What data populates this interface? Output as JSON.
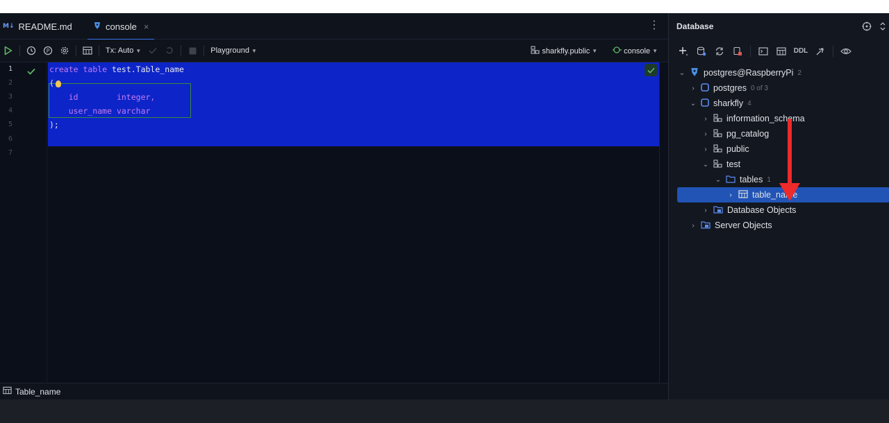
{
  "tabs": [
    {
      "badge": "M↓",
      "label": "README.md"
    },
    {
      "label": "console",
      "close": "×"
    }
  ],
  "toolbar": {
    "tx_mode": "Tx: Auto",
    "playground": "Playground",
    "schema": "sharkfly.public",
    "session": "console"
  },
  "editor": {
    "line_numbers": [
      "1",
      "2",
      "3",
      "4",
      "5",
      "6",
      "7"
    ],
    "code": {
      "l1_kw1": "create",
      "l1_kw2": "table",
      "l1_name": "test.Table_name",
      "l2": "(",
      "l3_col": "id",
      "l3_type": "integer,",
      "l4_col": "user_name",
      "l4_type": "varchar",
      "l5": ");"
    }
  },
  "status": {
    "label": "Table_name"
  },
  "database": {
    "title": "Database",
    "ddl": "DDL",
    "tree": [
      {
        "label": "postgres@RaspberryPi",
        "count": "2"
      },
      {
        "label": "postgres",
        "count": "0 of 3"
      },
      {
        "label": "sharkfly",
        "count": "4"
      },
      {
        "label": "information_schema"
      },
      {
        "label": "pg_catalog"
      },
      {
        "label": "public"
      },
      {
        "label": "test"
      },
      {
        "label": "tables",
        "count": "1"
      },
      {
        "label": "table_name"
      },
      {
        "label": "Database Objects"
      },
      {
        "label": "Server Objects"
      }
    ]
  },
  "colors": {
    "accent": "#3574f0",
    "selection": "#0d24c8",
    "tree_selected": "#2154b5",
    "annotation": "#ee2a2a"
  }
}
